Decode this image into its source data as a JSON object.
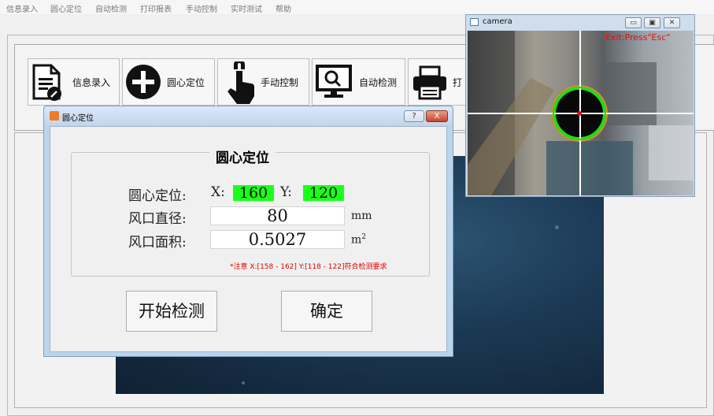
{
  "menu": {
    "items": [
      "信息录入",
      "圆心定位",
      "自动检测",
      "打印报表",
      "手动控制",
      "实时测试",
      "帮助"
    ]
  },
  "toolbar": {
    "info_entry": "信息录入",
    "center_locate": "圆心定位",
    "manual_control": "手动控制",
    "auto_detect": "自动检测",
    "print_partial": "打"
  },
  "dialog": {
    "title": "圆心定位",
    "help_button": "?",
    "close_button": "X",
    "group_title": "圆心定位",
    "center_label": "圆心定位:",
    "x_label": "X:",
    "x_value": "160",
    "y_label": "Y:",
    "y_value": "120",
    "diameter_label": "风口直径:",
    "diameter_value": "80",
    "diameter_unit": "mm",
    "area_label": "风口面积:",
    "area_value": "0.5027",
    "area_unit": "m",
    "area_unit_sup": "2",
    "note": "*注意 X:[158 - 162] Y:[118 - 122]符合检测要求",
    "start_button": "开始检测",
    "confirm_button": "确定"
  },
  "camera": {
    "title": "camera",
    "exit_hint": "Exit:Press\"Esc\""
  },
  "colors": {
    "highlight_green": "#1bff1b",
    "note_red": "#e00000",
    "circle_green": "#18e018",
    "crosshair": "#ffffff"
  }
}
